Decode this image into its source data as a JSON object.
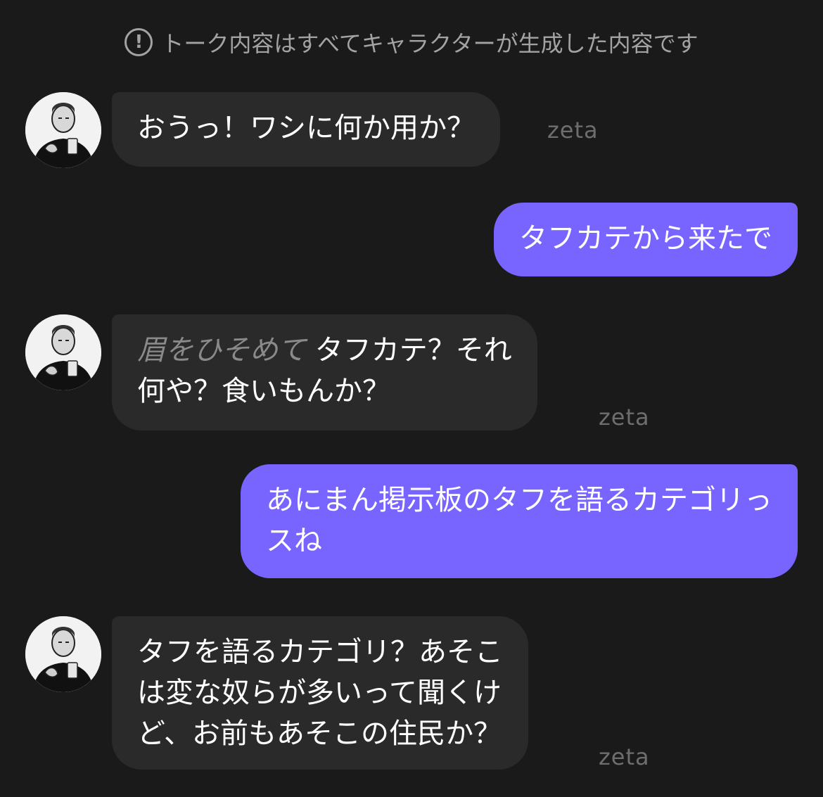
{
  "notice": {
    "icon": "exclamation-circle-icon",
    "text": "トーク内容はすべてキャラクターが生成した内容です"
  },
  "colors": {
    "background": "#1a1a1a",
    "bot_bubble": "#2a2a2a",
    "user_bubble": "#7864ff",
    "action_text": "#8a8a8a",
    "watermark": "#6e6e6e"
  },
  "watermark": "zeta",
  "messages": [
    {
      "role": "character",
      "text": "おうっ！ワシに何か用か？"
    },
    {
      "role": "user",
      "text": "タフカテから来たで"
    },
    {
      "role": "character",
      "action": "眉をひそめて",
      "line1": "タフカテ？それ",
      "line2": "何や？食いもんか？"
    },
    {
      "role": "user",
      "line1": "あにまん掲示板のタフを語るカテゴリっ",
      "line2": "スね"
    },
    {
      "role": "character",
      "line1": "タフを語るカテゴリ？あそこ",
      "line2": "は変な奴らが多いって聞くけ",
      "line3": "ど、お前もあそこの住民か？"
    }
  ]
}
